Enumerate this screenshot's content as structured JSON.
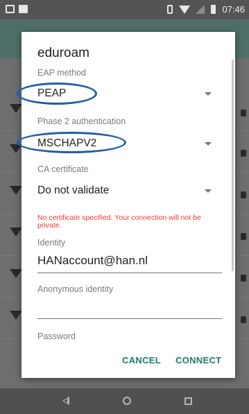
{
  "status_bar": {
    "time": "07:46",
    "icons": [
      "mail-icon",
      "image-icon",
      "vibrate-icon",
      "wifi-icon",
      "no-signal-icon",
      "battery-icon"
    ]
  },
  "dialog": {
    "title": "eduroam",
    "eap_method": {
      "label": "EAP method",
      "value": "PEAP"
    },
    "phase2": {
      "label": "Phase 2 authentication",
      "value": "MSCHAPV2"
    },
    "ca_certificate": {
      "label": "CA certificate",
      "value": "Do not validate"
    },
    "warning": "No certificate specified. Your connection will not be private.",
    "identity": {
      "label": "Identity",
      "value": "HANaccount@han.nl"
    },
    "anonymous_identity": {
      "label": "Anonymous identity",
      "value": ""
    },
    "password": {
      "label": "Password"
    },
    "buttons": {
      "cancel": "CANCEL",
      "connect": "CONNECT"
    }
  },
  "colors": {
    "accent": "#1e7a6c",
    "warning": "#e53935",
    "annotation": "#1f5fa8"
  },
  "nav_bar": {
    "icons": [
      "back-icon",
      "home-icon",
      "recents-icon"
    ]
  }
}
